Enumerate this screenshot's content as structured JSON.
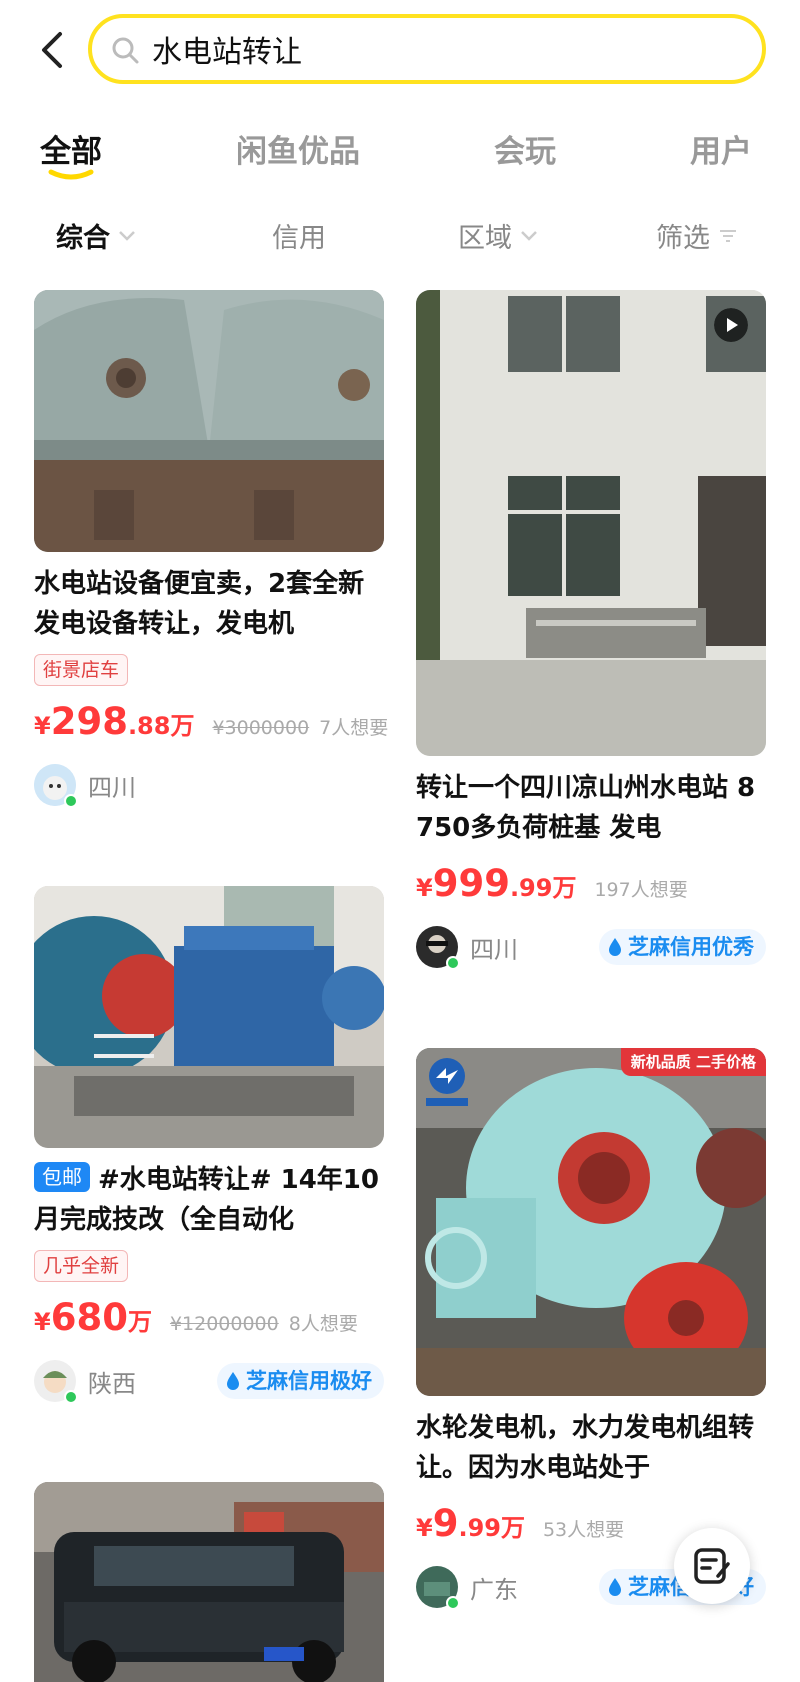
{
  "search": {
    "value": "水电站转让"
  },
  "tabs": [
    {
      "label": "全部",
      "active": true
    },
    {
      "label": "闲鱼优品",
      "active": false
    },
    {
      "label": "会玩",
      "active": false
    },
    {
      "label": "用户",
      "active": false
    }
  ],
  "filters": [
    {
      "label": "综合",
      "active": true,
      "icon": "chevron-down-icon"
    },
    {
      "label": "信用",
      "active": false
    },
    {
      "label": "区域",
      "active": false,
      "icon": "chevron-down-icon"
    },
    {
      "label": "筛选",
      "active": false,
      "icon": "filter-icon"
    }
  ],
  "items": [
    {
      "title": "水电站设备便宜卖，2套全新发电设备转让，发电机",
      "tag": "街景店车",
      "price_symbol": "¥",
      "price_int": "298",
      "price_dec": ".88",
      "price_unit": "万",
      "old_price": "¥3000000",
      "wants": "7人想要",
      "region": "四川"
    },
    {
      "title": "转让一个四川凉山州水电站  8750多负荷桩基  发电",
      "price_symbol": "¥",
      "price_int": "999",
      "price_dec": ".99",
      "price_unit": "万",
      "wants": "197人想要",
      "region": "四川",
      "credit": "芝麻信用优秀",
      "has_video": true
    },
    {
      "badge": "包邮",
      "title": "#水电站转让# 14年10月完成技改（全自动化",
      "tag": "几乎全新",
      "price_symbol": "¥",
      "price_int": "680",
      "price_dec": "",
      "price_unit": "万",
      "old_price": "¥12000000",
      "wants": "8人想要",
      "region": "陕西",
      "credit": "芝麻信用极好"
    },
    {
      "corner_badge": "新机品质  二手价格",
      "title": "水轮发电机，水力发电机组转让。因为水电站处于",
      "price_symbol": "¥",
      "price_int": "9",
      "price_dec": ".99",
      "price_unit": "万",
      "wants": "53人想要",
      "region": "广东",
      "credit": "芝麻信用极好"
    }
  ],
  "colors": {
    "accent_yellow": "#ffe21f",
    "price_red": "#ff3a3a",
    "credit_blue": "#1a8cf0"
  }
}
